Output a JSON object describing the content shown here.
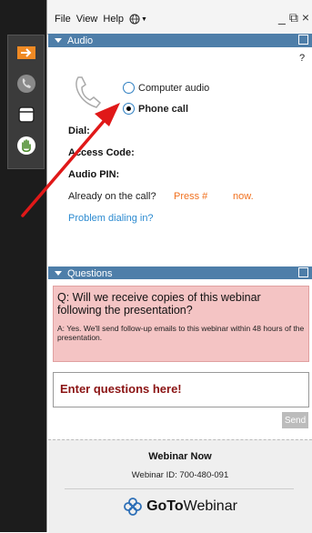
{
  "menubar": {
    "items": [
      "File",
      "View",
      "Help"
    ],
    "globe_icon": "globe-icon",
    "window_controls": [
      "minimize-icon",
      "restore-icon",
      "close-icon"
    ]
  },
  "dock": {
    "buttons": [
      "arrow-right-icon",
      "phone-icon",
      "window-icon",
      "raise-hand-icon"
    ]
  },
  "audio": {
    "header": "Audio",
    "help": "?",
    "options": [
      {
        "label": "Computer audio",
        "selected": false
      },
      {
        "label": "Phone call",
        "selected": true
      }
    ],
    "dial_label": "Dial:",
    "access_code_label": "Access Code:",
    "audio_pin_label": "Audio PIN:",
    "already_on_call": "Already on the call?",
    "press_hash": "Press #",
    "now": "now.",
    "problem_link": "Problem dialing in?"
  },
  "questions": {
    "header": "Questions",
    "question": "Q: Will we receive copies of this webinar following the presentation?",
    "answer": "A: Yes. We'll send follow-up emails to this webinar within 48 hours of the presentation.",
    "input_placeholder": "Enter questions here!",
    "send_label": "Send"
  },
  "footer": {
    "title": "Webinar Now",
    "webinar_id": "Webinar ID: 700-480-091",
    "brand_go": "GoTo",
    "brand_webinar": "Webinar"
  },
  "colors": {
    "header_blue": "#4e7ea9",
    "accent_orange": "#f0701e",
    "link_blue": "#2b8ad0",
    "question_bg": "#f4c4c4",
    "annotation_arrow": "#e01818"
  }
}
